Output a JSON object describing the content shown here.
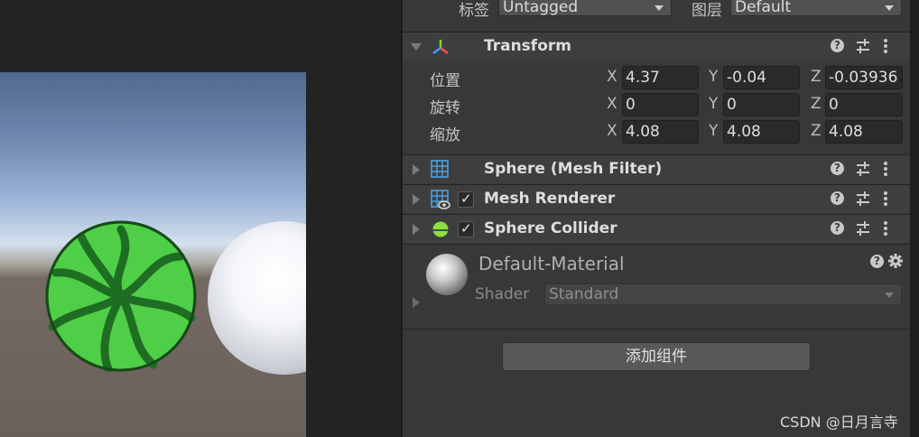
{
  "header": {
    "tag_label": "标签",
    "tag_value": "Untagged",
    "layer_label": "图层",
    "layer_value": "Default"
  },
  "transform": {
    "title": "Transform",
    "rows": [
      {
        "label": "位置",
        "x": "4.37",
        "y": "-0.04",
        "z": "-0.03936"
      },
      {
        "label": "旋转",
        "x": "0",
        "y": "0",
        "z": "0"
      },
      {
        "label": "缩放",
        "x": "4.08",
        "y": "4.08",
        "z": "4.08"
      }
    ],
    "axis": {
      "x": "X",
      "y": "Y",
      "z": "Z"
    }
  },
  "components": [
    {
      "title": "Sphere (Mesh Filter)",
      "icon": "mesh-filter-icon",
      "enabled": null
    },
    {
      "title": "Mesh Renderer",
      "icon": "mesh-renderer-icon",
      "enabled": true
    },
    {
      "title": "Sphere Collider",
      "icon": "sphere-collider-icon",
      "enabled": true
    }
  ],
  "material": {
    "name": "Default-Material",
    "shader_label": "Shader",
    "shader_value": "Standard"
  },
  "add_component_label": "添加组件",
  "help_glyph": "?",
  "check_glyph": "✓",
  "watermark": "CSDN @日月言寺",
  "colors": {
    "inspector_bg": "#383838",
    "header_bg": "#3e3e3e",
    "field_bg": "#2a2a2a",
    "watermelon_light": "#4fcf47",
    "watermelon_dark": "#1f6d22"
  }
}
